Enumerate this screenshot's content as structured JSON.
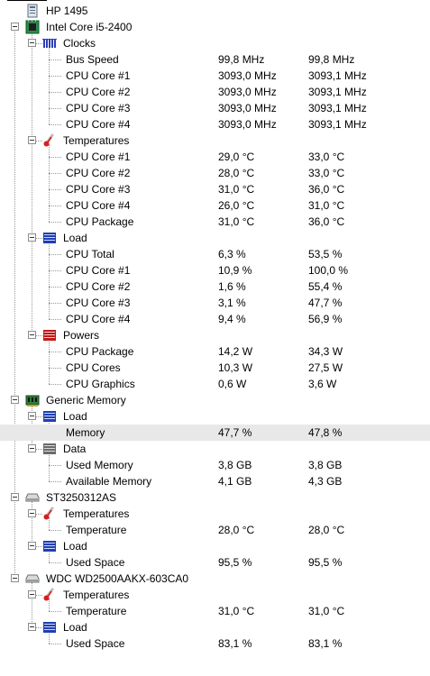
{
  "tree": [
    {
      "depth": 0,
      "label": "HP 1495",
      "icon": "computer-icon",
      "expander": false
    },
    {
      "depth": 0,
      "label": "Intel Core i5-2400",
      "icon": "cpu-icon",
      "expander": true
    },
    {
      "depth": 1,
      "label": "Clocks",
      "icon": "clock-icon",
      "expander": true
    },
    {
      "depth": 2,
      "label": "Bus Speed",
      "v1": "99,8 MHz",
      "v2": "99,8 MHz"
    },
    {
      "depth": 2,
      "label": "CPU Core #1",
      "v1": "3093,0 MHz",
      "v2": "3093,1 MHz"
    },
    {
      "depth": 2,
      "label": "CPU Core #2",
      "v1": "3093,0 MHz",
      "v2": "3093,1 MHz"
    },
    {
      "depth": 2,
      "label": "CPU Core #3",
      "v1": "3093,0 MHz",
      "v2": "3093,1 MHz"
    },
    {
      "depth": 2,
      "label": "CPU Core #4",
      "v1": "3093,0 MHz",
      "v2": "3093,1 MHz"
    },
    {
      "depth": 1,
      "label": "Temperatures",
      "icon": "thermometer-icon",
      "expander": true
    },
    {
      "depth": 2,
      "label": "CPU Core #1",
      "v1": "29,0 °C",
      "v2": "33,0 °C"
    },
    {
      "depth": 2,
      "label": "CPU Core #2",
      "v1": "28,0 °C",
      "v2": "33,0 °C"
    },
    {
      "depth": 2,
      "label": "CPU Core #3",
      "v1": "31,0 °C",
      "v2": "36,0 °C"
    },
    {
      "depth": 2,
      "label": "CPU Core #4",
      "v1": "26,0 °C",
      "v2": "31,0 °C"
    },
    {
      "depth": 2,
      "label": "CPU Package",
      "v1": "31,0 °C",
      "v2": "36,0 °C"
    },
    {
      "depth": 1,
      "label": "Load",
      "icon": "load-icon",
      "expander": true
    },
    {
      "depth": 2,
      "label": "CPU Total",
      "v1": "6,3 %",
      "v2": "53,5 %"
    },
    {
      "depth": 2,
      "label": "CPU Core #1",
      "v1": "10,9 %",
      "v2": "100,0 %"
    },
    {
      "depth": 2,
      "label": "CPU Core #2",
      "v1": "1,6 %",
      "v2": "55,4 %"
    },
    {
      "depth": 2,
      "label": "CPU Core #3",
      "v1": "3,1 %",
      "v2": "47,7 %"
    },
    {
      "depth": 2,
      "label": "CPU Core #4",
      "v1": "9,4 %",
      "v2": "56,9 %"
    },
    {
      "depth": 1,
      "label": "Powers",
      "icon": "power-icon",
      "expander": true
    },
    {
      "depth": 2,
      "label": "CPU Package",
      "v1": "14,2 W",
      "v2": "34,3 W"
    },
    {
      "depth": 2,
      "label": "CPU Cores",
      "v1": "10,3 W",
      "v2": "27,5 W"
    },
    {
      "depth": 2,
      "label": "CPU Graphics",
      "v1": "0,6 W",
      "v2": "3,6 W"
    },
    {
      "depth": 0,
      "label": "Generic Memory",
      "icon": "memory-icon",
      "expander": true
    },
    {
      "depth": 1,
      "label": "Load",
      "icon": "load-icon",
      "expander": true
    },
    {
      "depth": 2,
      "label": "Memory",
      "v1": "47,7 %",
      "v2": "47,8 %",
      "selected": true
    },
    {
      "depth": 1,
      "label": "Data",
      "icon": "data-icon",
      "expander": true
    },
    {
      "depth": 2,
      "label": "Used Memory",
      "v1": "3,8 GB",
      "v2": "3,8 GB"
    },
    {
      "depth": 2,
      "label": "Available Memory",
      "v1": "4,1 GB",
      "v2": "4,3 GB"
    },
    {
      "depth": 0,
      "label": "ST3250312AS",
      "icon": "hdd-icon",
      "expander": true
    },
    {
      "depth": 1,
      "label": "Temperatures",
      "icon": "thermometer-icon",
      "expander": true
    },
    {
      "depth": 2,
      "label": "Temperature",
      "v1": "28,0 °C",
      "v2": "28,0 °C"
    },
    {
      "depth": 1,
      "label": "Load",
      "icon": "load-icon",
      "expander": true
    },
    {
      "depth": 2,
      "label": "Used Space",
      "v1": "95,5 %",
      "v2": "95,5 %"
    },
    {
      "depth": 0,
      "label": "WDC WD2500AAKX-603CA0",
      "icon": "hdd-icon",
      "expander": true
    },
    {
      "depth": 1,
      "label": "Temperatures",
      "icon": "thermometer-icon",
      "expander": true
    },
    {
      "depth": 2,
      "label": "Temperature",
      "v1": "31,0 °C",
      "v2": "31,0 °C"
    },
    {
      "depth": 1,
      "label": "Load",
      "icon": "load-icon",
      "expander": true
    },
    {
      "depth": 2,
      "label": "Used Space",
      "v1": "83,1 %",
      "v2": "83,1 %"
    }
  ],
  "colors": {
    "selected_row": "#e8e8e8",
    "tree_lines": "#9a9a9a",
    "load_blue": "#1f3fb0",
    "power_red": "#c01818",
    "thermo_red": "#d81e1e"
  }
}
